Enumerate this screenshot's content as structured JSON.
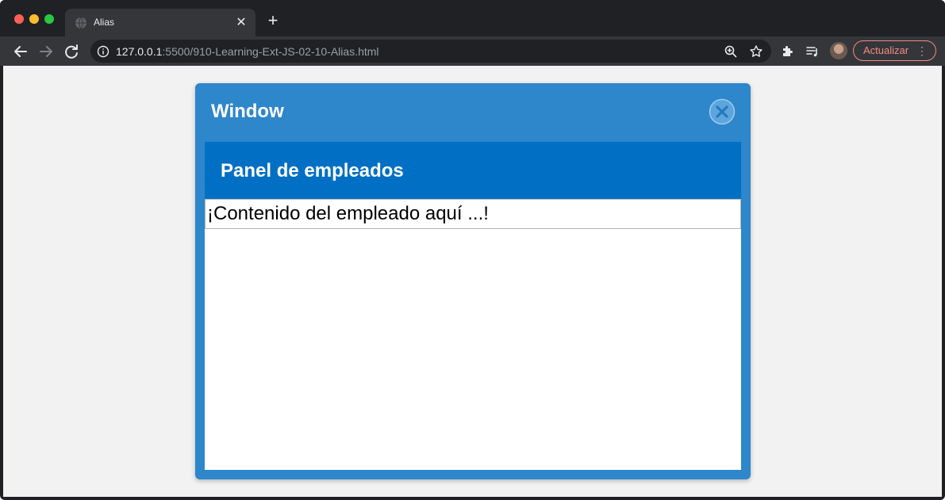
{
  "browser": {
    "tab": {
      "title": "Alias",
      "close_icon": "close-icon",
      "favicon": "globe-icon"
    },
    "new_tab_icon": "plus-icon",
    "address": {
      "host": "127.0.0.1",
      "path": ":5500/910-Learning-Ext-JS-02-10-Alias.html"
    },
    "update_button": {
      "label": "Actualizar"
    },
    "colors": {
      "chrome_dark": "#202124",
      "toolbar": "#35363a",
      "update_accent": "#f28b82"
    }
  },
  "window": {
    "title": "Window",
    "close_icon": "close-circle-icon",
    "colors": {
      "frame": "#2e86cb",
      "panel_header": "#0170c4"
    },
    "panel": {
      "title": "Panel de empleados",
      "content": "¡Contenido del empleado aquí ...!"
    }
  }
}
